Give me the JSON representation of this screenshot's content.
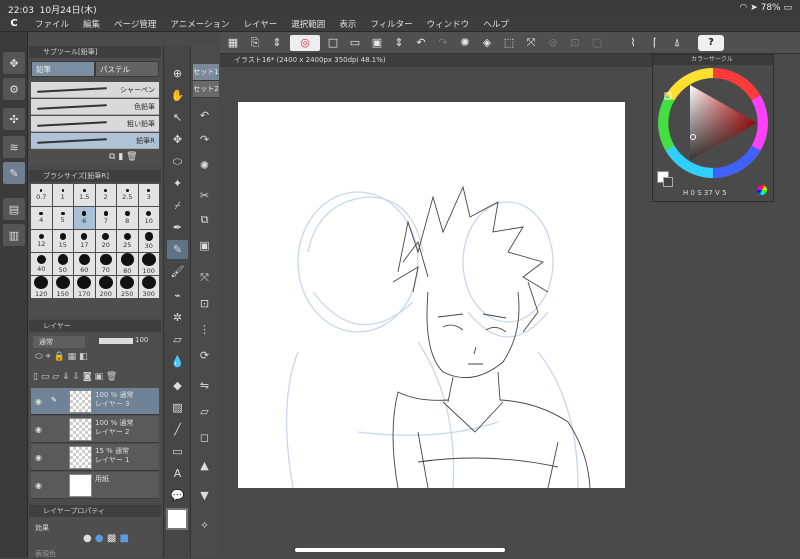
{
  "status_bar": {
    "time": "22:03",
    "date": "10月24日(木)",
    "battery": "78%"
  },
  "menu": [
    "ファイル",
    "編集",
    "ページ管理",
    "アニメーション",
    "レイヤー",
    "選択範囲",
    "表示",
    "フィルター",
    "ウィンドウ",
    "ヘルプ"
  ],
  "command_bar": {
    "help_label": "?"
  },
  "subtool": {
    "title": "サブツール[鉛筆]",
    "tabs": [
      "鉛筆",
      "パステル"
    ],
    "brushes": [
      "シャーペン",
      "色鉛筆",
      "粗い鉛筆",
      "鉛筆R"
    ]
  },
  "brush_size": {
    "title": "ブラシサイズ[鉛筆R]",
    "sizes": [
      "0.7",
      "1",
      "1.5",
      "2",
      "2.5",
      "3",
      "4",
      "5",
      "6",
      "7",
      "8",
      "10",
      "12",
      "15",
      "17",
      "20",
      "25",
      "30",
      "40",
      "50",
      "60",
      "70",
      "80",
      "100",
      "120",
      "150",
      "170",
      "200",
      "250",
      "300"
    ],
    "selected": "6"
  },
  "layer": {
    "title": "レイヤー",
    "blend": "通常",
    "opacity": "100",
    "layers": [
      {
        "line1": "100 % 通常",
        "line2": "レイヤー 3",
        "selected": true
      },
      {
        "line1": "100 % 通常",
        "line2": "レイヤー 2",
        "selected": false
      },
      {
        "line1": "15 % 通常",
        "line2": "レイヤー 1",
        "selected": false
      },
      {
        "line1": "",
        "line2": "用紙",
        "selected": false
      }
    ]
  },
  "layer_property": {
    "title": "レイヤープロパティ",
    "effect_label": "効果",
    "extra_label": "表現色"
  },
  "set_tabs": [
    "セット1",
    "セット2"
  ],
  "document": {
    "tab_title": "イラスト16* (2400 x 2400px 350dpi 48.1%)"
  },
  "color_panel": {
    "title": "カラーサークル",
    "h": "0",
    "s": "37",
    "v": "5"
  },
  "colors": {
    "accent": "#7c8fa2",
    "paper": "#ffffff",
    "sketch_blue": "#c7d7ea"
  }
}
